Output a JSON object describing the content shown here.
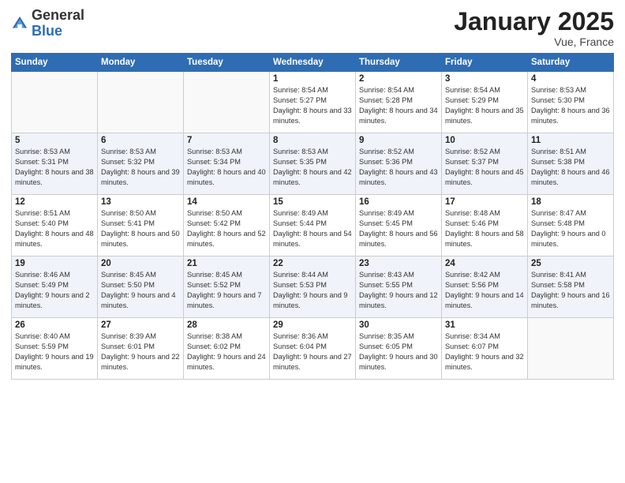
{
  "logo": {
    "general": "General",
    "blue": "Blue"
  },
  "title": "January 2025",
  "location": "Vue, France",
  "days_header": [
    "Sunday",
    "Monday",
    "Tuesday",
    "Wednesday",
    "Thursday",
    "Friday",
    "Saturday"
  ],
  "weeks": [
    [
      {
        "num": "",
        "sunrise": "",
        "sunset": "",
        "daylight": ""
      },
      {
        "num": "",
        "sunrise": "",
        "sunset": "",
        "daylight": ""
      },
      {
        "num": "",
        "sunrise": "",
        "sunset": "",
        "daylight": ""
      },
      {
        "num": "1",
        "sunrise": "Sunrise: 8:54 AM",
        "sunset": "Sunset: 5:27 PM",
        "daylight": "Daylight: 8 hours and 33 minutes."
      },
      {
        "num": "2",
        "sunrise": "Sunrise: 8:54 AM",
        "sunset": "Sunset: 5:28 PM",
        "daylight": "Daylight: 8 hours and 34 minutes."
      },
      {
        "num": "3",
        "sunrise": "Sunrise: 8:54 AM",
        "sunset": "Sunset: 5:29 PM",
        "daylight": "Daylight: 8 hours and 35 minutes."
      },
      {
        "num": "4",
        "sunrise": "Sunrise: 8:53 AM",
        "sunset": "Sunset: 5:30 PM",
        "daylight": "Daylight: 8 hours and 36 minutes."
      }
    ],
    [
      {
        "num": "5",
        "sunrise": "Sunrise: 8:53 AM",
        "sunset": "Sunset: 5:31 PM",
        "daylight": "Daylight: 8 hours and 38 minutes."
      },
      {
        "num": "6",
        "sunrise": "Sunrise: 8:53 AM",
        "sunset": "Sunset: 5:32 PM",
        "daylight": "Daylight: 8 hours and 39 minutes."
      },
      {
        "num": "7",
        "sunrise": "Sunrise: 8:53 AM",
        "sunset": "Sunset: 5:34 PM",
        "daylight": "Daylight: 8 hours and 40 minutes."
      },
      {
        "num": "8",
        "sunrise": "Sunrise: 8:53 AM",
        "sunset": "Sunset: 5:35 PM",
        "daylight": "Daylight: 8 hours and 42 minutes."
      },
      {
        "num": "9",
        "sunrise": "Sunrise: 8:52 AM",
        "sunset": "Sunset: 5:36 PM",
        "daylight": "Daylight: 8 hours and 43 minutes."
      },
      {
        "num": "10",
        "sunrise": "Sunrise: 8:52 AM",
        "sunset": "Sunset: 5:37 PM",
        "daylight": "Daylight: 8 hours and 45 minutes."
      },
      {
        "num": "11",
        "sunrise": "Sunrise: 8:51 AM",
        "sunset": "Sunset: 5:38 PM",
        "daylight": "Daylight: 8 hours and 46 minutes."
      }
    ],
    [
      {
        "num": "12",
        "sunrise": "Sunrise: 8:51 AM",
        "sunset": "Sunset: 5:40 PM",
        "daylight": "Daylight: 8 hours and 48 minutes."
      },
      {
        "num": "13",
        "sunrise": "Sunrise: 8:50 AM",
        "sunset": "Sunset: 5:41 PM",
        "daylight": "Daylight: 8 hours and 50 minutes."
      },
      {
        "num": "14",
        "sunrise": "Sunrise: 8:50 AM",
        "sunset": "Sunset: 5:42 PM",
        "daylight": "Daylight: 8 hours and 52 minutes."
      },
      {
        "num": "15",
        "sunrise": "Sunrise: 8:49 AM",
        "sunset": "Sunset: 5:44 PM",
        "daylight": "Daylight: 8 hours and 54 minutes."
      },
      {
        "num": "16",
        "sunrise": "Sunrise: 8:49 AM",
        "sunset": "Sunset: 5:45 PM",
        "daylight": "Daylight: 8 hours and 56 minutes."
      },
      {
        "num": "17",
        "sunrise": "Sunrise: 8:48 AM",
        "sunset": "Sunset: 5:46 PM",
        "daylight": "Daylight: 8 hours and 58 minutes."
      },
      {
        "num": "18",
        "sunrise": "Sunrise: 8:47 AM",
        "sunset": "Sunset: 5:48 PM",
        "daylight": "Daylight: 9 hours and 0 minutes."
      }
    ],
    [
      {
        "num": "19",
        "sunrise": "Sunrise: 8:46 AM",
        "sunset": "Sunset: 5:49 PM",
        "daylight": "Daylight: 9 hours and 2 minutes."
      },
      {
        "num": "20",
        "sunrise": "Sunrise: 8:45 AM",
        "sunset": "Sunset: 5:50 PM",
        "daylight": "Daylight: 9 hours and 4 minutes."
      },
      {
        "num": "21",
        "sunrise": "Sunrise: 8:45 AM",
        "sunset": "Sunset: 5:52 PM",
        "daylight": "Daylight: 9 hours and 7 minutes."
      },
      {
        "num": "22",
        "sunrise": "Sunrise: 8:44 AM",
        "sunset": "Sunset: 5:53 PM",
        "daylight": "Daylight: 9 hours and 9 minutes."
      },
      {
        "num": "23",
        "sunrise": "Sunrise: 8:43 AM",
        "sunset": "Sunset: 5:55 PM",
        "daylight": "Daylight: 9 hours and 12 minutes."
      },
      {
        "num": "24",
        "sunrise": "Sunrise: 8:42 AM",
        "sunset": "Sunset: 5:56 PM",
        "daylight": "Daylight: 9 hours and 14 minutes."
      },
      {
        "num": "25",
        "sunrise": "Sunrise: 8:41 AM",
        "sunset": "Sunset: 5:58 PM",
        "daylight": "Daylight: 9 hours and 16 minutes."
      }
    ],
    [
      {
        "num": "26",
        "sunrise": "Sunrise: 8:40 AM",
        "sunset": "Sunset: 5:59 PM",
        "daylight": "Daylight: 9 hours and 19 minutes."
      },
      {
        "num": "27",
        "sunrise": "Sunrise: 8:39 AM",
        "sunset": "Sunset: 6:01 PM",
        "daylight": "Daylight: 9 hours and 22 minutes."
      },
      {
        "num": "28",
        "sunrise": "Sunrise: 8:38 AM",
        "sunset": "Sunset: 6:02 PM",
        "daylight": "Daylight: 9 hours and 24 minutes."
      },
      {
        "num": "29",
        "sunrise": "Sunrise: 8:36 AM",
        "sunset": "Sunset: 6:04 PM",
        "daylight": "Daylight: 9 hours and 27 minutes."
      },
      {
        "num": "30",
        "sunrise": "Sunrise: 8:35 AM",
        "sunset": "Sunset: 6:05 PM",
        "daylight": "Daylight: 9 hours and 30 minutes."
      },
      {
        "num": "31",
        "sunrise": "Sunrise: 8:34 AM",
        "sunset": "Sunset: 6:07 PM",
        "daylight": "Daylight: 9 hours and 32 minutes."
      },
      {
        "num": "",
        "sunrise": "",
        "sunset": "",
        "daylight": ""
      }
    ]
  ]
}
